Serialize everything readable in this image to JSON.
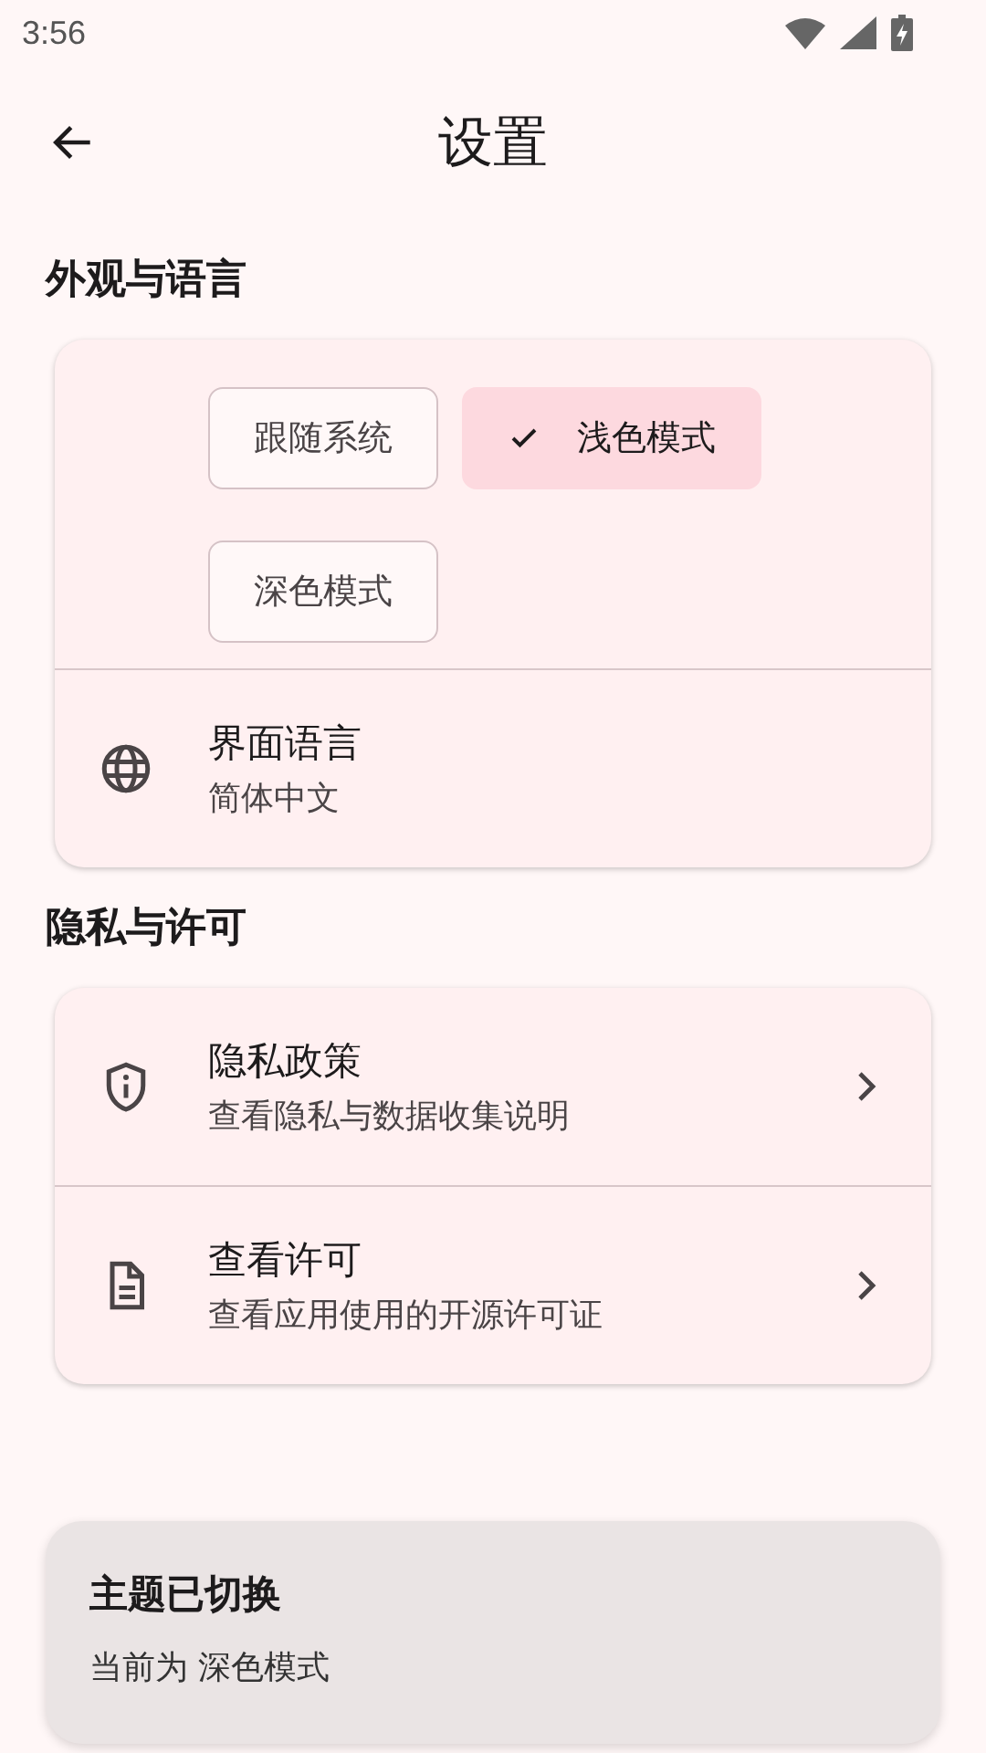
{
  "status_bar": {
    "time": "3:56"
  },
  "top_bar": {
    "title": "设置"
  },
  "sections": [
    {
      "title": "外观与语言",
      "theme_options": [
        {
          "label": "跟随系统",
          "selected": false
        },
        {
          "label": "浅色模式",
          "selected": true
        },
        {
          "label": "深色模式",
          "selected": false
        }
      ],
      "items": [
        {
          "kind": "globe",
          "title": "界面语言",
          "subtitle": "简体中文",
          "chevron": false
        }
      ]
    },
    {
      "title": "隐私与许可",
      "items": [
        {
          "kind": "shield",
          "title": "隐私政策",
          "subtitle": "查看隐私与数据收集说明",
          "chevron": true
        },
        {
          "kind": "document",
          "title": "查看许可",
          "subtitle": "查看应用使用的开源许可证",
          "chevron": true
        }
      ]
    }
  ],
  "snackbar": {
    "title": "主题已切换",
    "message": "当前为 深色模式"
  }
}
